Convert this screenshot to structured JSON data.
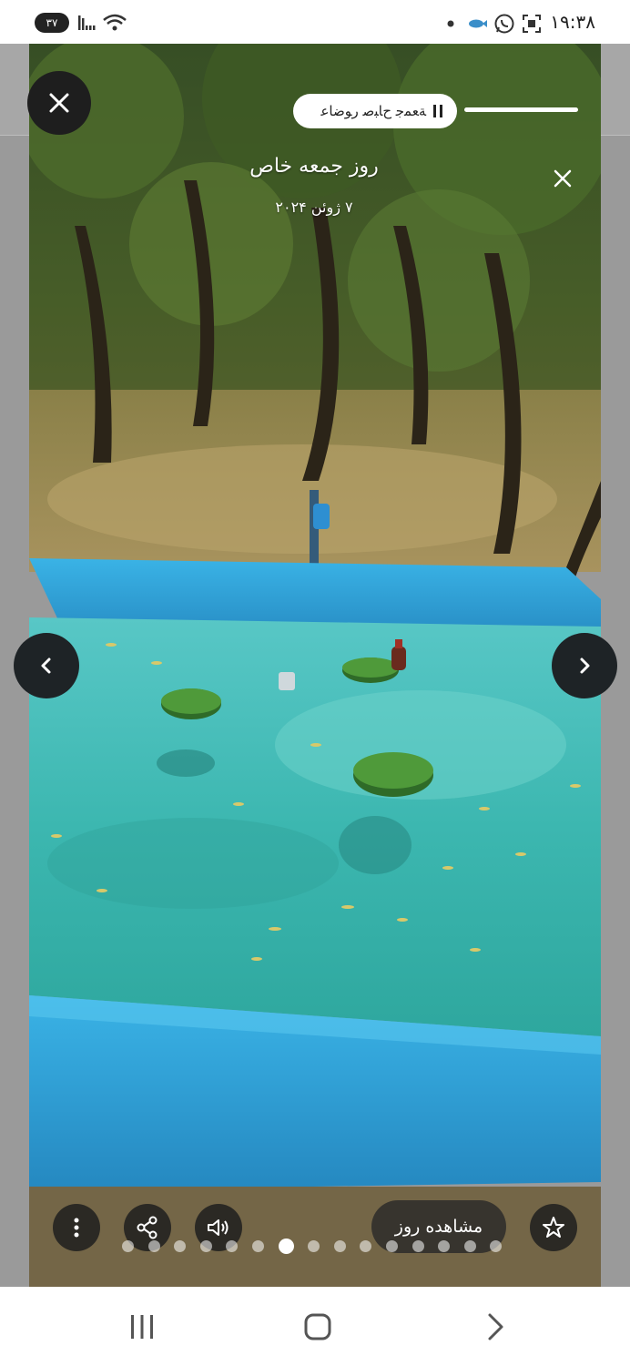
{
  "status_bar": {
    "time": "۱۹:۳۸",
    "battery": "۳۷",
    "icons": [
      "dot-icon",
      "fish-icon",
      "whatsapp-icon",
      "screenshot-icon",
      "wifi-icon",
      "signal-icon"
    ]
  },
  "story": {
    "progress_label": "ﺔﻌﻤﺟ ﺡﺎﺒﺻ ﺭﻮﺿﺎﻋ",
    "title": "روز جمعه خاص",
    "date": "۷ ژوئن ۲۰۲۴",
    "total_pages": 15,
    "current_page": 7
  },
  "actions": {
    "view_day_label": "مشاهده روز"
  },
  "icons": {
    "close": "close-icon",
    "prev": "chevron-left-icon",
    "next": "chevron-right-icon",
    "more": "more-vertical-icon",
    "share": "share-icon",
    "volume": "volume-icon",
    "star": "star-icon"
  },
  "colors": {
    "pool": "#2ea8d8",
    "water": "#3fb9b0",
    "overlay_button": "#1e2326"
  }
}
